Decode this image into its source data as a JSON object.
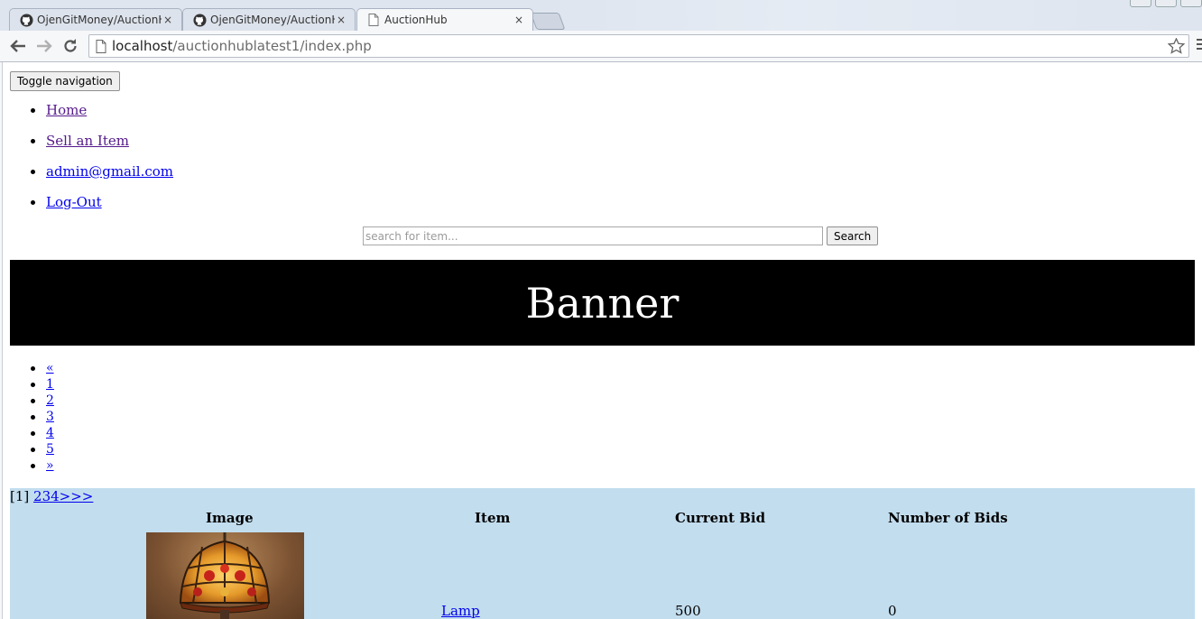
{
  "browser": {
    "tabs": [
      {
        "title": "OjenGitMoney/AuctionHu",
        "icon": "github-icon",
        "active": false
      },
      {
        "title": "OjenGitMoney/AuctionHu",
        "icon": "github-icon",
        "active": false
      },
      {
        "title": "AuctionHub",
        "icon": "page-icon",
        "active": true
      }
    ],
    "close_glyph": "×",
    "url_host": "localhost",
    "url_path": "/auctionhublatest1/index.php"
  },
  "page": {
    "toggle_label": "Toggle navigation",
    "nav_items": [
      "Home",
      "Sell an Item",
      "admin@gmail.com",
      "Log-Out"
    ],
    "search": {
      "placeholder": "search for item...",
      "value": "",
      "button": "Search"
    },
    "banner": "Banner",
    "pager": [
      "«",
      "1",
      "2",
      "3",
      "4",
      "5",
      "»"
    ],
    "listing": {
      "current_page": "[1]",
      "page_links": "234>>>",
      "headers": [
        "Image",
        "Item",
        "Current Bid",
        "Number of Bids"
      ],
      "rows": [
        {
          "image": "lamp",
          "item": "Lamp",
          "current_bid": "500",
          "bids": "0"
        }
      ]
    }
  },
  "colors": {
    "banner_bg": "#000000",
    "listing_bg": "#c2ddee",
    "link": "#0000ee",
    "visited_link": "#551a8b"
  }
}
